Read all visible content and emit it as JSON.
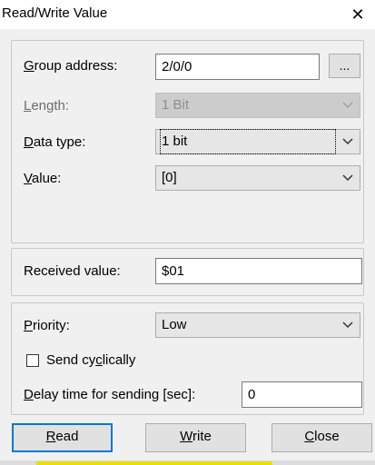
{
  "window": {
    "title": "Read/Write Value",
    "close_glyph": "✕"
  },
  "address": {
    "group_address_label": "Group address:",
    "group_address_value": "2/0/0",
    "browse_label": "...",
    "length_label": "Length:",
    "length_value": "1 Bit",
    "data_type_label": "Data type:",
    "data_type_value": "1 bit",
    "value_label": "Value:",
    "value_value": "[0]"
  },
  "received": {
    "label": "Received value:",
    "value": "$01"
  },
  "options": {
    "priority_label": "Priority:",
    "priority_value": "Low",
    "send_cyclically_label": "Send cyclically",
    "send_cyclically_checked": false,
    "delay_label": "Delay time for sending [sec]:",
    "delay_value": "0"
  },
  "buttons": {
    "read": "Read",
    "write": "Write",
    "close": "Close"
  },
  "icons": {
    "dropdown": "chevron-down-icon",
    "close": "close-icon"
  }
}
